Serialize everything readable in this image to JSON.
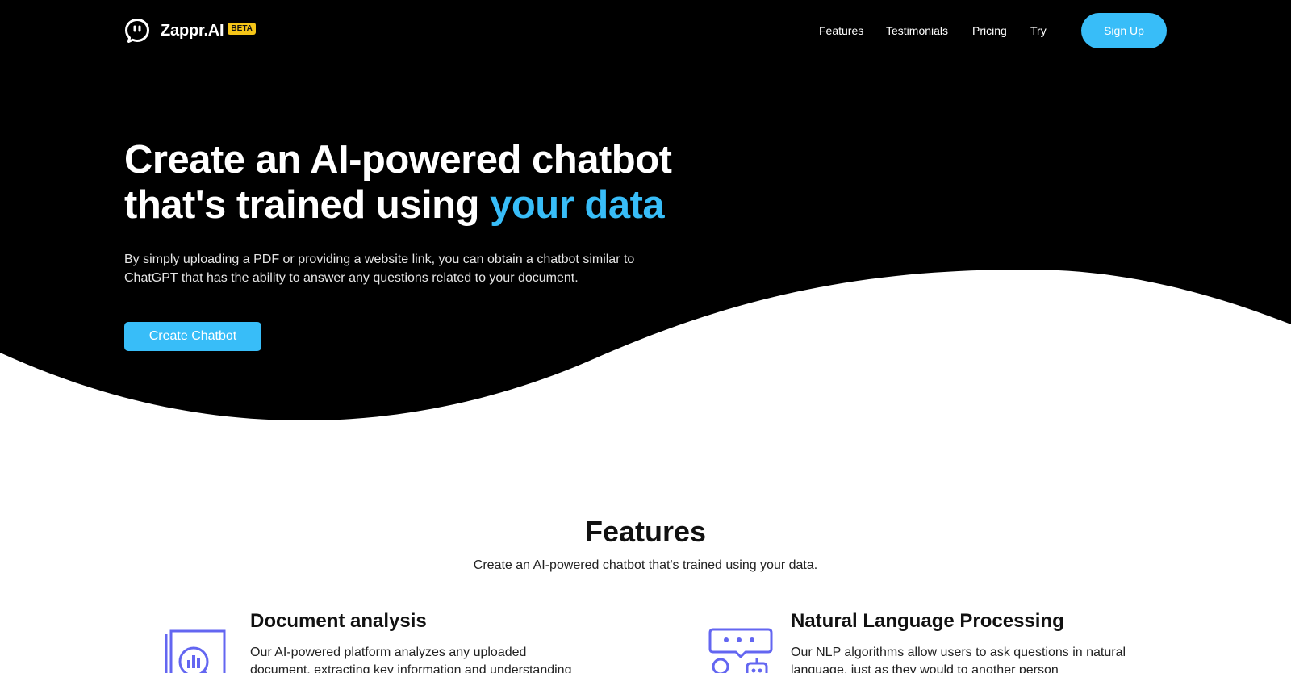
{
  "brand": {
    "name": "Zappr.AI",
    "badge": "BETA"
  },
  "nav": {
    "links": [
      "Features",
      "Testimonials",
      "Pricing",
      "Try"
    ],
    "signup_label": "Sign Up"
  },
  "hero": {
    "title_line1": "Create an AI-powered chatbot",
    "title_line2_prefix": "that's trained using ",
    "title_accent": "your data",
    "description": "By simply uploading a PDF or providing a website link, you can obtain a chatbot similar to ChatGPT that has the ability to answer any questions related to your document.",
    "cta_label": "Create Chatbot"
  },
  "features": {
    "title": "Features",
    "subtitle": "Create an AI-powered chatbot that's trained using your data.",
    "items": [
      {
        "title": "Document analysis",
        "text": "Our AI-powered platform analyzes any uploaded document, extracting key information and understanding",
        "icon": "document-analysis-icon"
      },
      {
        "title": "Natural Language Processing",
        "text": "Our NLP algorithms allow users to ask questions in natural language, just as they would to another person",
        "icon": "chat-robot-icon"
      }
    ]
  },
  "colors": {
    "hero_background": "#000000",
    "accent": "#38bdf8",
    "badge": "#f5c518",
    "icon": "#6366f1"
  }
}
